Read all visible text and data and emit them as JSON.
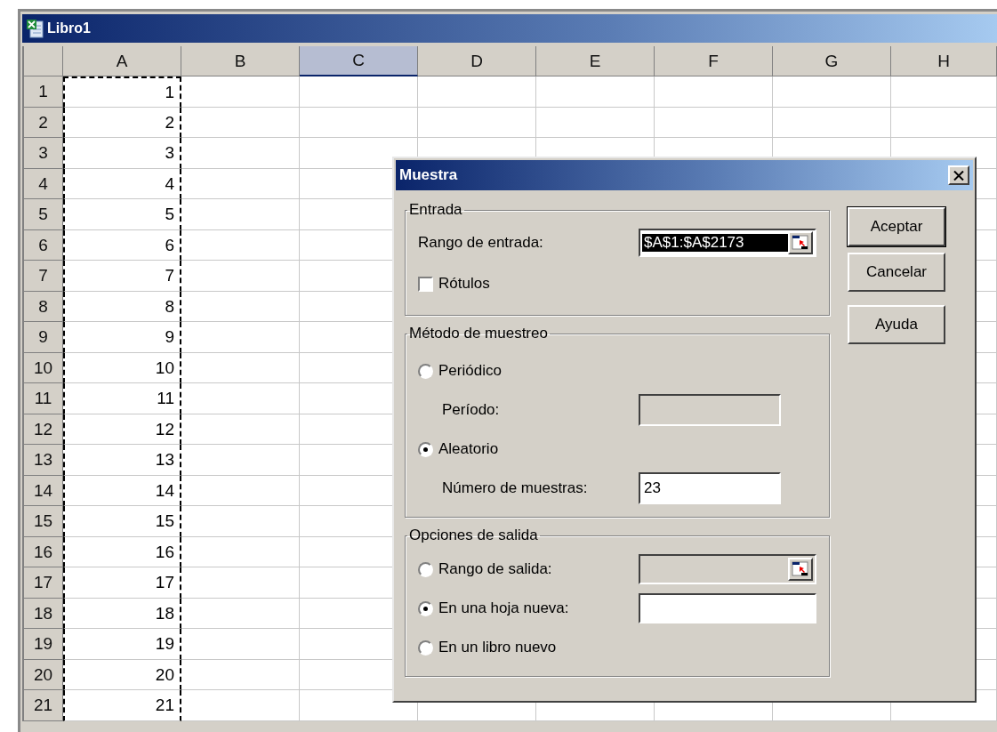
{
  "window": {
    "title": "Libro1"
  },
  "sheet": {
    "copy_marquee": true,
    "columns": [
      {
        "label": "A",
        "selected": false
      },
      {
        "label": "B",
        "selected": false
      },
      {
        "label": "C",
        "selected": true
      },
      {
        "label": "D",
        "selected": false
      },
      {
        "label": "E",
        "selected": false
      },
      {
        "label": "F",
        "selected": false
      },
      {
        "label": "G",
        "selected": false
      },
      {
        "label": "H",
        "selected": false
      }
    ],
    "rows": [
      {
        "header": "1",
        "a": "1"
      },
      {
        "header": "2",
        "a": "2"
      },
      {
        "header": "3",
        "a": "3"
      },
      {
        "header": "4",
        "a": "4"
      },
      {
        "header": "5",
        "a": "5"
      },
      {
        "header": "6",
        "a": "6"
      },
      {
        "header": "7",
        "a": "7"
      },
      {
        "header": "8",
        "a": "8"
      },
      {
        "header": "9",
        "a": "9"
      },
      {
        "header": "10",
        "a": "10"
      },
      {
        "header": "11",
        "a": "11"
      },
      {
        "header": "12",
        "a": "12"
      },
      {
        "header": "13",
        "a": "13"
      },
      {
        "header": "14",
        "a": "14"
      },
      {
        "header": "15",
        "a": "15"
      },
      {
        "header": "16",
        "a": "16"
      },
      {
        "header": "17",
        "a": "17"
      },
      {
        "header": "18",
        "a": "18"
      },
      {
        "header": "19",
        "a": "19"
      },
      {
        "header": "20",
        "a": "20"
      },
      {
        "header": "21",
        "a": "21"
      }
    ]
  },
  "dialog": {
    "title": "Muestra",
    "input_group": {
      "legend": "Entrada",
      "range_label": "Rango de entrada:",
      "range_value": "$A$1:$A$2173",
      "range_value_highlighted": true,
      "labels_checkbox": {
        "label": "Rótulos",
        "checked": false
      }
    },
    "method_group": {
      "legend": "Método de muestreo",
      "options": [
        {
          "label": "Periódico",
          "selected": false,
          "field_label": "Período:",
          "field_disabled": true
        },
        {
          "label": "Aleatorio",
          "selected": true,
          "field_label": "Número de muestras:",
          "field_value": "23",
          "field_disabled": false
        }
      ]
    },
    "output_group": {
      "legend": "Opciones de salida",
      "options": [
        {
          "label": "Rango de salida:",
          "selected": false,
          "kind": "ref",
          "field_disabled": true
        },
        {
          "label": "En una hoja nueva:",
          "selected": true,
          "kind": "text",
          "field_disabled": false
        },
        {
          "label": "En un libro nuevo",
          "selected": false,
          "kind": "none"
        }
      ]
    },
    "buttons": [
      {
        "label": "Aceptar",
        "default": true
      },
      {
        "label": "Cancelar",
        "default": false
      },
      {
        "label": "Ayuda",
        "default": false
      }
    ]
  }
}
